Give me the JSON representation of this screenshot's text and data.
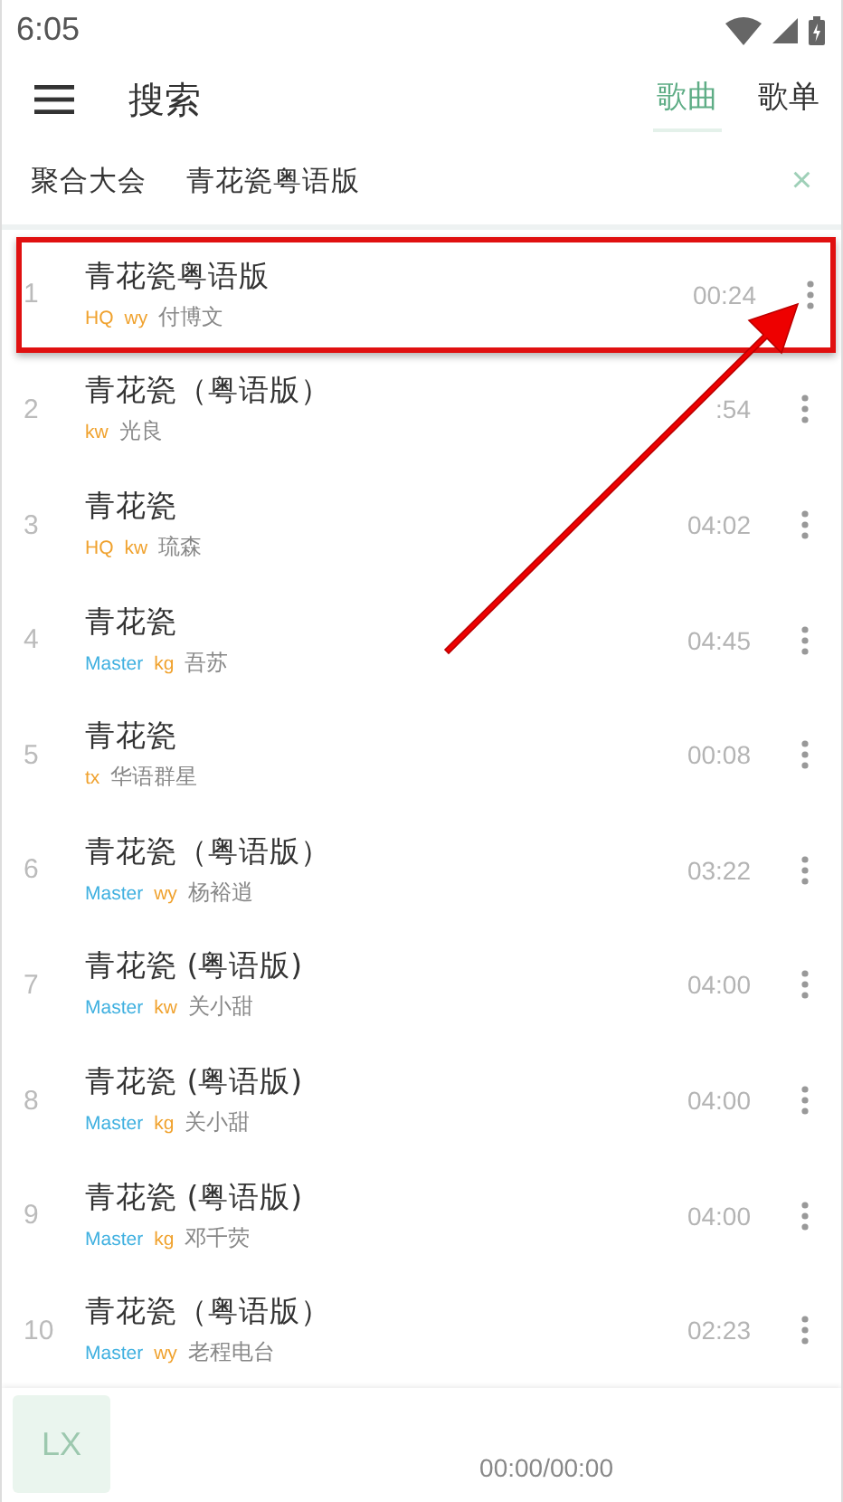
{
  "status_bar": {
    "time": "6:05"
  },
  "header": {
    "title": "搜索",
    "tabs": [
      {
        "label": "歌曲",
        "selected": true
      },
      {
        "label": "歌单",
        "selected": false
      }
    ]
  },
  "search": {
    "source": "聚合大会",
    "value": "青花瓷粤语版",
    "clear": "×"
  },
  "songs": [
    {
      "index": "1",
      "title": "青花瓷粤语版",
      "tags": [
        {
          "label": "HQ",
          "color": "#f0a22e"
        },
        {
          "label": "wy",
          "color": "#f0a22e"
        }
      ],
      "artist": "付博文",
      "duration": "00:24",
      "highlighted": true
    },
    {
      "index": "2",
      "title": "青花瓷（粤语版）",
      "tags": [
        {
          "label": "kw",
          "color": "#f0a22e"
        }
      ],
      "artist": "光良",
      "duration": ":54",
      "highlighted": false
    },
    {
      "index": "3",
      "title": "青花瓷",
      "tags": [
        {
          "label": "HQ",
          "color": "#f0a22e"
        },
        {
          "label": "kw",
          "color": "#f0a22e"
        }
      ],
      "artist": "琉森",
      "duration": "04:02",
      "highlighted": false
    },
    {
      "index": "4",
      "title": "青花瓷",
      "tags": [
        {
          "label": "Master",
          "color": "#3fb0e0"
        },
        {
          "label": "kg",
          "color": "#f0a22e"
        }
      ],
      "artist": "吾苏",
      "duration": "04:45",
      "highlighted": false
    },
    {
      "index": "5",
      "title": "青花瓷",
      "tags": [
        {
          "label": "tx",
          "color": "#f0a22e"
        }
      ],
      "artist": "华语群星",
      "duration": "00:08",
      "highlighted": false
    },
    {
      "index": "6",
      "title": "青花瓷（粤语版）",
      "tags": [
        {
          "label": "Master",
          "color": "#3fb0e0"
        },
        {
          "label": "wy",
          "color": "#f0a22e"
        }
      ],
      "artist": "杨裕逍",
      "duration": "03:22",
      "highlighted": false
    },
    {
      "index": "7",
      "title": "青花瓷 (粤语版)",
      "tags": [
        {
          "label": "Master",
          "color": "#3fb0e0"
        },
        {
          "label": "kw",
          "color": "#f0a22e"
        }
      ],
      "artist": "关小甜",
      "duration": "04:00",
      "highlighted": false
    },
    {
      "index": "8",
      "title": "青花瓷 (粤语版)",
      "tags": [
        {
          "label": "Master",
          "color": "#3fb0e0"
        },
        {
          "label": "kg",
          "color": "#f0a22e"
        }
      ],
      "artist": "关小甜",
      "duration": "04:00",
      "highlighted": false
    },
    {
      "index": "9",
      "title": "青花瓷 (粤语版)",
      "tags": [
        {
          "label": "Master",
          "color": "#3fb0e0"
        },
        {
          "label": "kg",
          "color": "#f0a22e"
        }
      ],
      "artist": "邓千荧",
      "duration": "04:00",
      "highlighted": false
    },
    {
      "index": "10",
      "title": "青花瓷（粤语版）",
      "tags": [
        {
          "label": "Master",
          "color": "#3fb0e0"
        },
        {
          "label": "wy",
          "color": "#f0a22e"
        }
      ],
      "artist": "老程电台",
      "duration": "02:23",
      "highlighted": false
    }
  ],
  "player": {
    "cover": "LX",
    "time": "00:00/00:00"
  }
}
